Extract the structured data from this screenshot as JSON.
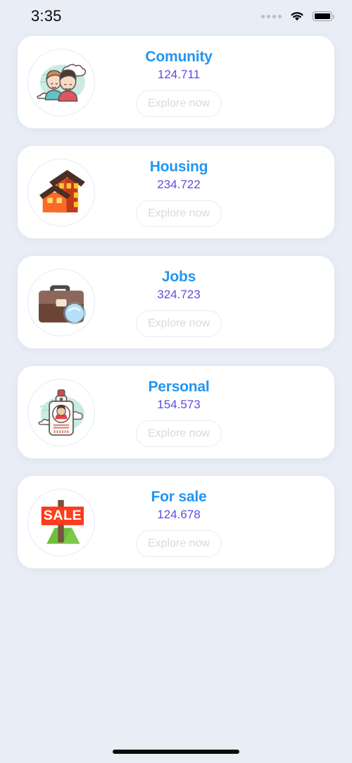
{
  "status_bar": {
    "time": "3:35",
    "signal_icon": "signal-dots-icon",
    "wifi_icon": "wifi-icon",
    "battery_icon": "battery-icon"
  },
  "theme": {
    "background": "#E9EDF6",
    "card_background": "#FFFFFF",
    "title_color": "#2196F3",
    "count_color": "#5B4DE0",
    "button_border": "#E9ECF1",
    "button_text": "#D6DAE0"
  },
  "cards": [
    {
      "id": "comunity",
      "title": "Comunity",
      "count": "124.711",
      "button_label": "Explore now",
      "icon": "community-people-icon"
    },
    {
      "id": "housing",
      "title": "Housing",
      "count": "234.722",
      "button_label": "Explore now",
      "icon": "houses-icon"
    },
    {
      "id": "jobs",
      "title": "Jobs",
      "count": "324.723",
      "button_label": "Explore now",
      "icon": "briefcase-search-icon"
    },
    {
      "id": "personal",
      "title": "Personal",
      "count": "154.573",
      "button_label": "Explore now",
      "icon": "id-badge-icon"
    },
    {
      "id": "for-sale",
      "title": "For sale",
      "count": "124.678",
      "button_label": "Explore now",
      "icon": "sale-sign-icon",
      "sign_text": "SALE"
    }
  ],
  "home_indicator": "home-indicator"
}
